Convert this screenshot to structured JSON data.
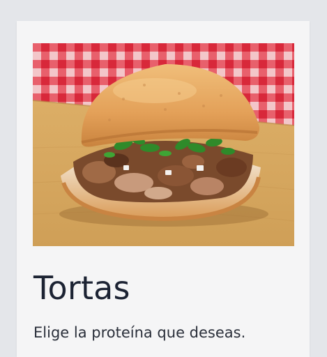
{
  "card": {
    "image_icon": "torta-sandwich-photo",
    "title": "Tortas",
    "subtitle": "Elige la proteína que deseas."
  },
  "colors": {
    "page_background": "#e4e6ea",
    "card_background": "#f5f5f6",
    "title_text": "#1c2333",
    "checkered_red": "#d8283a",
    "board_wood": "#d9ab63",
    "bread": "#e7a65c"
  }
}
